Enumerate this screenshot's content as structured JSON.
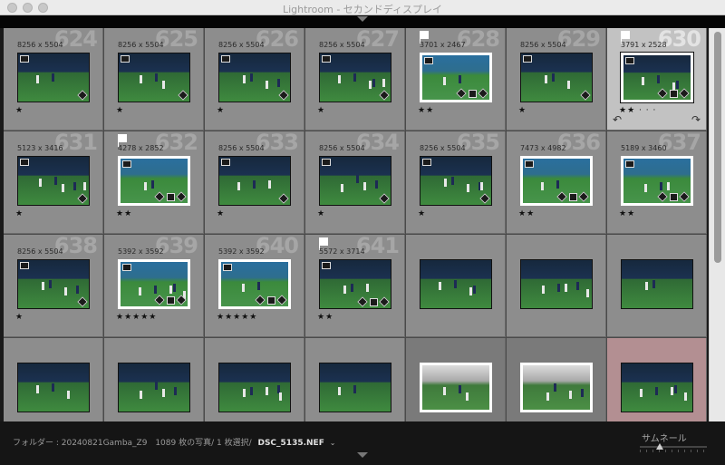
{
  "window": {
    "title": "Lightroom - セカンドディスプレイ"
  },
  "grid": {
    "rows": [
      [
        {
          "num": "624",
          "dims": "8256 x 5504",
          "stars": "★",
          "flag": false,
          "style": "pitch"
        },
        {
          "num": "625",
          "dims": "8256 x 5504",
          "stars": "★",
          "flag": false,
          "style": "pitch"
        },
        {
          "num": "626",
          "dims": "8256 x 5504",
          "stars": "★",
          "flag": false,
          "style": "pitch"
        },
        {
          "num": "627",
          "dims": "8256 x 5504",
          "stars": "★",
          "flag": false,
          "style": "pitch"
        },
        {
          "num": "628",
          "dims": "3701 x 2467",
          "stars": "★★",
          "flag": true,
          "style": "teal"
        },
        {
          "num": "629",
          "dims": "8256 x 5504",
          "stars": "★",
          "flag": false,
          "style": "pitch"
        },
        {
          "num": "630",
          "dims": "3791 x 2528",
          "stars": "★★ · · ·",
          "flag": true,
          "style": "pitch",
          "selected": true
        }
      ],
      [
        {
          "num": "631",
          "dims": "5123 x 3416",
          "stars": "★",
          "flag": false,
          "style": "pitch"
        },
        {
          "num": "632",
          "dims": "4278 x 2852",
          "stars": "★★",
          "flag": true,
          "style": "teal"
        },
        {
          "num": "633",
          "dims": "8256 x 5504",
          "stars": "★",
          "flag": false,
          "style": "pitch"
        },
        {
          "num": "634",
          "dims": "8256 x 5504",
          "stars": "★",
          "flag": false,
          "style": "pitch"
        },
        {
          "num": "635",
          "dims": "8256 x 5504",
          "stars": "★",
          "flag": false,
          "style": "pitch"
        },
        {
          "num": "636",
          "dims": "7473 x 4982",
          "stars": "★★",
          "flag": false,
          "style": "teal"
        },
        {
          "num": "637",
          "dims": "5189 x 3460",
          "stars": "★★",
          "flag": false,
          "style": "teal"
        }
      ],
      [
        {
          "num": "638",
          "dims": "8256 x 5504",
          "stars": "★",
          "flag": false,
          "style": "pitch"
        },
        {
          "num": "639",
          "dims": "5392 x 3592",
          "stars": "★★★★★",
          "flag": false,
          "style": "teal"
        },
        {
          "num": "640",
          "dims": "5392 x 3592",
          "stars": "★★★★★",
          "flag": false,
          "style": "teal"
        },
        {
          "num": "641",
          "dims": "5572 x 3714",
          "stars": "★★",
          "flag": true,
          "style": "pitch"
        },
        {
          "num": "",
          "dims": "",
          "stars": "",
          "flag": false,
          "style": "pitch"
        },
        {
          "num": "",
          "dims": "",
          "stars": "",
          "flag": false,
          "style": "pitch"
        },
        {
          "num": "",
          "dims": "",
          "stars": "",
          "flag": false,
          "style": "pitch"
        }
      ],
      [
        {
          "num": "",
          "dims": "",
          "stars": "",
          "flag": false,
          "style": "pitch"
        },
        {
          "num": "",
          "dims": "",
          "stars": "",
          "flag": false,
          "style": "pitch"
        },
        {
          "num": "",
          "dims": "",
          "stars": "",
          "flag": false,
          "style": "pitch"
        },
        {
          "num": "",
          "dims": "",
          "stars": "",
          "flag": false,
          "style": "pitch"
        },
        {
          "num": "",
          "dims": "",
          "stars": "",
          "flag": false,
          "style": "stands",
          "dim": true
        },
        {
          "num": "",
          "dims": "",
          "stars": "",
          "flag": false,
          "style": "stands",
          "dim": true
        },
        {
          "num": "",
          "dims": "",
          "stars": "",
          "flag": false,
          "style": "pitch",
          "reject": true
        }
      ]
    ]
  },
  "statusbar": {
    "folder_label": "フォルダー : 20240821Gamba_Z9",
    "count_text": "1089 枚の写真/ 1 枚選択/",
    "filename": "DSC_5135.NEF",
    "caret": "⌄",
    "thumbnail_label": "サムネール"
  }
}
